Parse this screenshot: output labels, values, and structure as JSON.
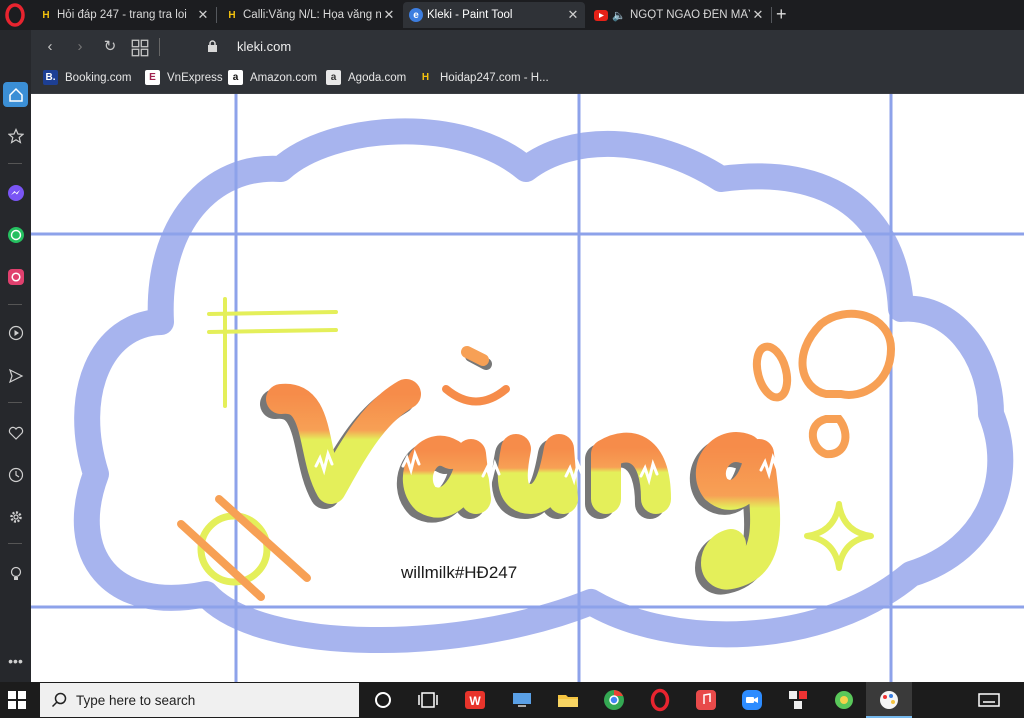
{
  "tabs": [
    {
      "title": "Hỏi đáp 247 - trang tra loi",
      "icon": "hoidap-h-icon"
    },
    {
      "title": "Calli:Vắng N/L: Họa vắng n",
      "icon": "hoidap-h-icon"
    },
    {
      "title": "Kleki - Paint Tool",
      "icon": "kleki-icon",
      "active": true
    },
    {
      "title": "NGỌT NGÀO ĐẾN MẤY",
      "icon": "youtube-icon"
    }
  ],
  "address": {
    "url": "kleki.com"
  },
  "bookmarks": [
    {
      "label": "Booking.com",
      "letter": "B."
    },
    {
      "label": "VnExpress",
      "letter": "E"
    },
    {
      "label": "Amazon.com",
      "letter": "a"
    },
    {
      "label": "Agoda.com",
      "letter": "a"
    },
    {
      "label": "Hoidap247.com - H...",
      "letter": "H"
    }
  ],
  "canvas": {
    "signature": "willmilk#HĐ247",
    "colors": {
      "cloud": "#a7b4ee",
      "grid": "#8da2ea",
      "orange": "#f7a055",
      "yellow": "#e4ef5a"
    }
  },
  "taskbar": {
    "search_placeholder": "Type here to search"
  }
}
